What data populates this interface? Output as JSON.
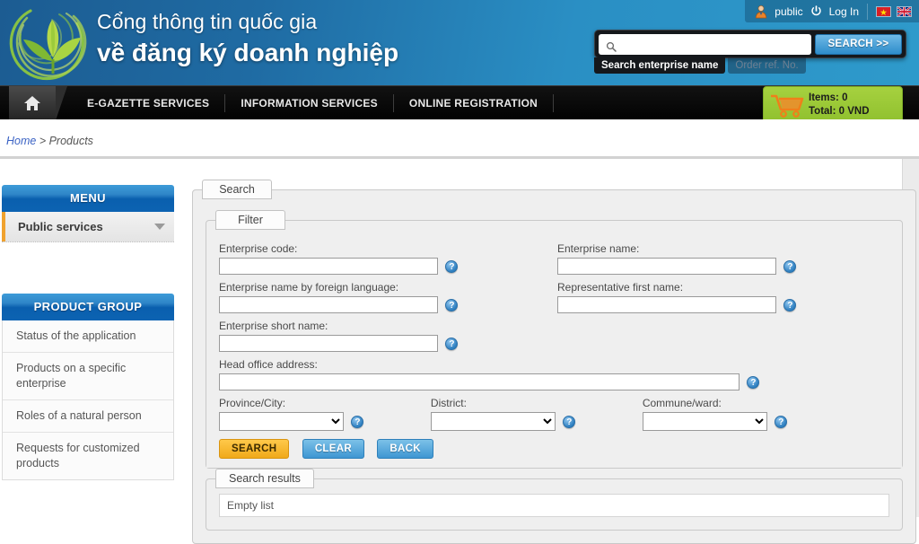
{
  "header": {
    "brand_line1": "Cổng thông tin quốc gia",
    "brand_line2": "về đăng ký doanh nghiệp",
    "logo_icon": "leaf-logo-icon",
    "user": {
      "avatar_icon": "user-avatar-icon",
      "username": "public",
      "power_icon": "power-icon",
      "login_label": "Log In",
      "flag_vn": "vietnam-flag-icon",
      "flag_en": "uk-flag-icon"
    },
    "search": {
      "value": "",
      "placeholder": "",
      "magnifier_icon": "search-icon",
      "button_label": "SEARCH >>",
      "tabs": [
        {
          "label": "Search enterprise name",
          "active": true
        },
        {
          "label": "Order ref. No.",
          "active": false
        }
      ]
    }
  },
  "nav": {
    "home_icon": "home-icon",
    "items": [
      {
        "label": "E-GAZETTE SERVICES"
      },
      {
        "label": "INFORMATION SERVICES"
      },
      {
        "label": "ONLINE REGISTRATION"
      }
    ]
  },
  "cart": {
    "icon": "shopping-cart-icon",
    "items_line": "Items: 0",
    "total_line": "Total: 0 VND"
  },
  "breadcrumb": {
    "home": "Home",
    "separator": " > ",
    "current": "Products"
  },
  "sidebar": {
    "menu": {
      "title": "MENU",
      "items": [
        {
          "label": "Public services",
          "caret": "chevron-down-icon"
        }
      ]
    },
    "product_group": {
      "title": "PRODUCT GROUP",
      "items": [
        {
          "label": "Status of the application"
        },
        {
          "label": "Products on a specific enterprise"
        },
        {
          "label": "Roles of a natural person"
        },
        {
          "label": "Requests for customized products"
        }
      ]
    }
  },
  "main": {
    "search_tab_label": "Search",
    "filter_tab_label": "Filter",
    "fields": {
      "enterprise_code": {
        "label": "Enterprise code:",
        "value": "",
        "help": "?"
      },
      "enterprise_name": {
        "label": "Enterprise name:",
        "value": "",
        "help": "?"
      },
      "enterprise_name_foreign": {
        "label": "Enterprise name by foreign language:",
        "value": "",
        "help": "?"
      },
      "representative_first_name": {
        "label": "Representative first name:",
        "value": "",
        "help": "?"
      },
      "enterprise_short_name": {
        "label": "Enterprise short name:",
        "value": "",
        "help": "?"
      },
      "head_office_address": {
        "label": "Head office address:",
        "value": "",
        "help": "?"
      },
      "province_city": {
        "label": "Province/City:",
        "value": "",
        "help": "?"
      },
      "district": {
        "label": "District:",
        "value": "",
        "help": "?"
      },
      "commune_ward": {
        "label": "Commune/ward:",
        "value": "",
        "help": "?"
      }
    },
    "buttons": {
      "search": "SEARCH",
      "clear": "CLEAR",
      "back": "BACK"
    },
    "results": {
      "tab_label": "Search results",
      "empty_text": "Empty list"
    }
  },
  "colors": {
    "header_blue": "#2a8fc4",
    "nav_black": "#0a0a0a",
    "panel_blue": "#0a5fae",
    "cart_green": "#a6d13f",
    "accent_orange": "#f0a22e",
    "search_button": "#f0a91a",
    "blue_button": "#3e96d2"
  }
}
